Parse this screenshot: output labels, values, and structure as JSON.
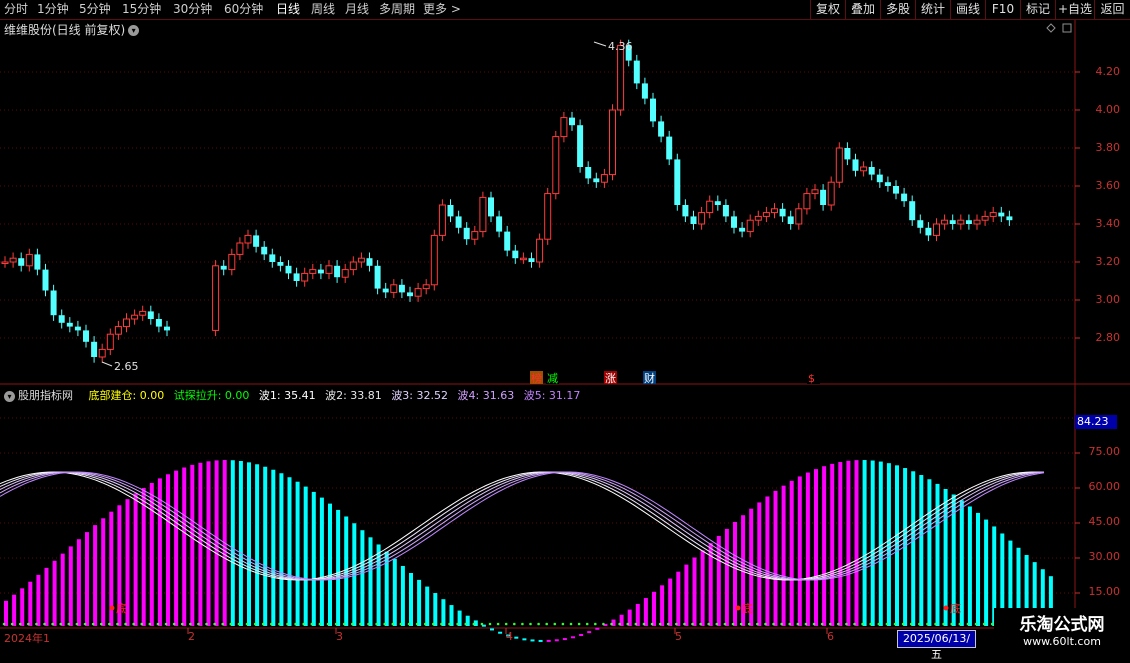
{
  "toolbar": {
    "periods": [
      "分时",
      "1分钟",
      "5分钟",
      "15分钟",
      "30分钟",
      "60分钟",
      "日线",
      "周线",
      "月线",
      "多周期",
      "更多 >"
    ],
    "active_period": "日线",
    "right_buttons": [
      "复权",
      "叠加",
      "多股",
      "统计",
      "画线",
      "F10",
      "标记",
      "+自选",
      "返回"
    ]
  },
  "main_chart": {
    "title": "维维股份(日线 前复权)",
    "collapse_icon": "chevron-down-icon",
    "y_axis_labels": [
      "4.20",
      "4.00",
      "3.80",
      "3.60",
      "3.40",
      "3.20",
      "3.00",
      "2.80"
    ],
    "high_label": "4.36",
    "low_label": "2.65",
    "event_markers": [
      {
        "text": "榜",
        "color": "#ff3030",
        "bg": "#a05000"
      },
      {
        "text": "减",
        "color": "#00ff00",
        "bg": "#000000"
      },
      {
        "text": "涨",
        "color": "#ffffff",
        "bg": "#a00000"
      },
      {
        "text": "财",
        "color": "#ffffff",
        "bg": "#004080"
      },
      {
        "text": "$",
        "color": "#ff3030",
        "bg": "#000000"
      }
    ]
  },
  "indicator": {
    "name": "股朋指标网",
    "bottom_build_label": "底部建仓: 0.00",
    "probe_label": "试探拉升: 0.00",
    "waves": [
      "波1: 35.41",
      "波2: 33.81",
      "波3: 32.52",
      "波4: 31.63",
      "波5: 31.17"
    ],
    "y_axis_labels": [
      "84.23",
      "75.00",
      "60.00",
      "45.00",
      "30.00",
      "15.00"
    ],
    "last_value": "84.23",
    "bottom_signal_text": "底"
  },
  "x_axis": {
    "month_labels": [
      "2024年1",
      "2",
      "3",
      "4",
      "5",
      "6"
    ],
    "cursor_date": "2025/06/13/五"
  },
  "brand": {
    "name": "乐淘公式网",
    "url": "www.60lt.com"
  },
  "colors": {
    "up": "#ff3c3c",
    "down": "#54ffff",
    "grid": "#5a0a0a",
    "magenta": "#ff00ff",
    "cyan": "#00ffff"
  }
}
